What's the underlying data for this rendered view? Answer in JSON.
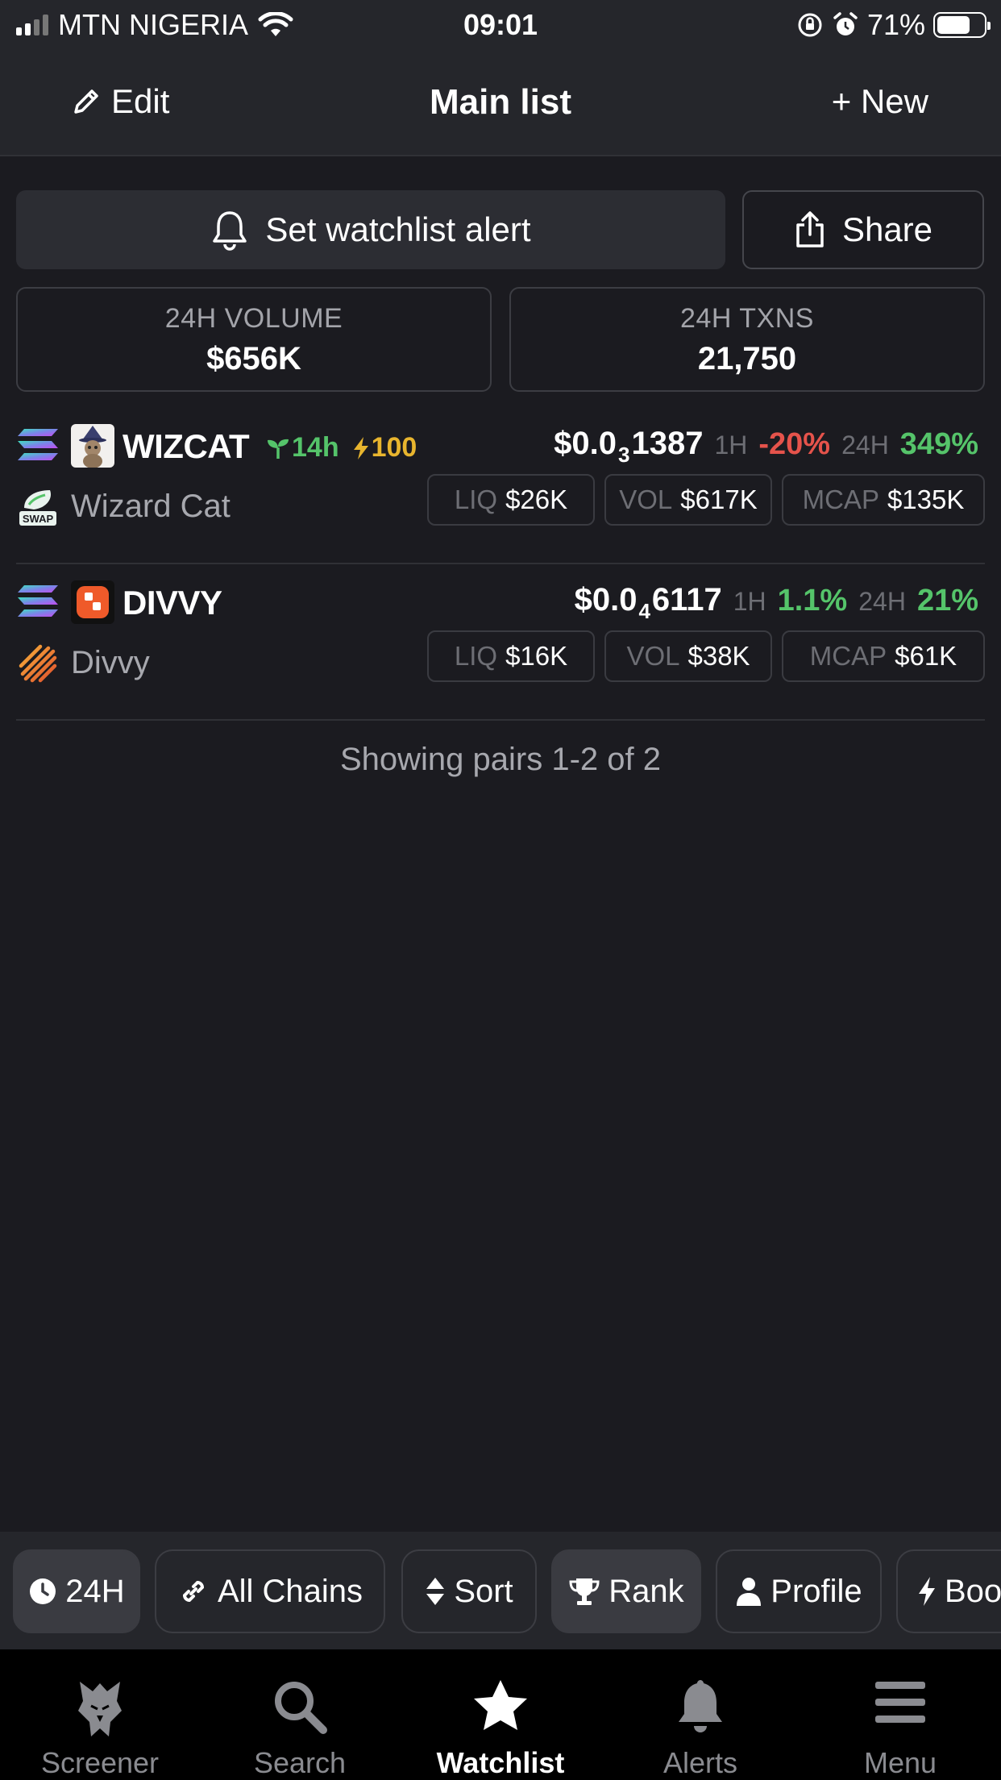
{
  "status_bar": {
    "carrier": "MTN NIGERIA",
    "time": "09:01",
    "battery": "71%"
  },
  "header": {
    "edit_label": "Edit",
    "title": "Main list",
    "new_label": "+ New"
  },
  "actions": {
    "alert_label": "Set watchlist alert",
    "share_label": "Share"
  },
  "stats": {
    "volume_label": "24H VOLUME",
    "volume_value": "$656K",
    "txns_label": "24H TXNS",
    "txns_value": "21,750"
  },
  "pairs": [
    {
      "symbol": "WIZCAT",
      "name": "Wizard Cat",
      "age": "14h",
      "boost": "100",
      "price_main": "$0.0",
      "price_zeros": "3",
      "price_tail": "1387",
      "h1_label": "1H",
      "h1_change": "-20%",
      "h24_label": "24H",
      "h24_change": "349%",
      "liq_label": "LIQ",
      "liq": "$26K",
      "vol_label": "VOL",
      "vol": "$617K",
      "mcap_label": "MCAP",
      "mcap": "$135K",
      "dex_badge": "SWAP"
    },
    {
      "symbol": "DIVVY",
      "name": "Divvy",
      "price_main": "$0.0",
      "price_zeros": "4",
      "price_tail": "6117",
      "h1_label": "1H",
      "h1_change": "1.1%",
      "h24_label": "24H",
      "h24_change": "21%",
      "liq_label": "LIQ",
      "liq": "$16K",
      "vol_label": "VOL",
      "vol": "$38K",
      "mcap_label": "MCAP",
      "mcap": "$61K"
    }
  ],
  "showing_text": "Showing pairs 1-2 of 2",
  "filters": {
    "timeframe": "24H",
    "chains": "All Chains",
    "sort": "Sort",
    "rank": "Rank",
    "profile": "Profile",
    "boosted": "Boo"
  },
  "nav": {
    "screener": "Screener",
    "search": "Search",
    "watchlist": "Watchlist",
    "alerts": "Alerts",
    "menu": "Menu"
  },
  "colors": {
    "background": "#1b1b20",
    "positive": "#55c46a",
    "negative": "#e5534b",
    "boost": "#e8b52e"
  }
}
